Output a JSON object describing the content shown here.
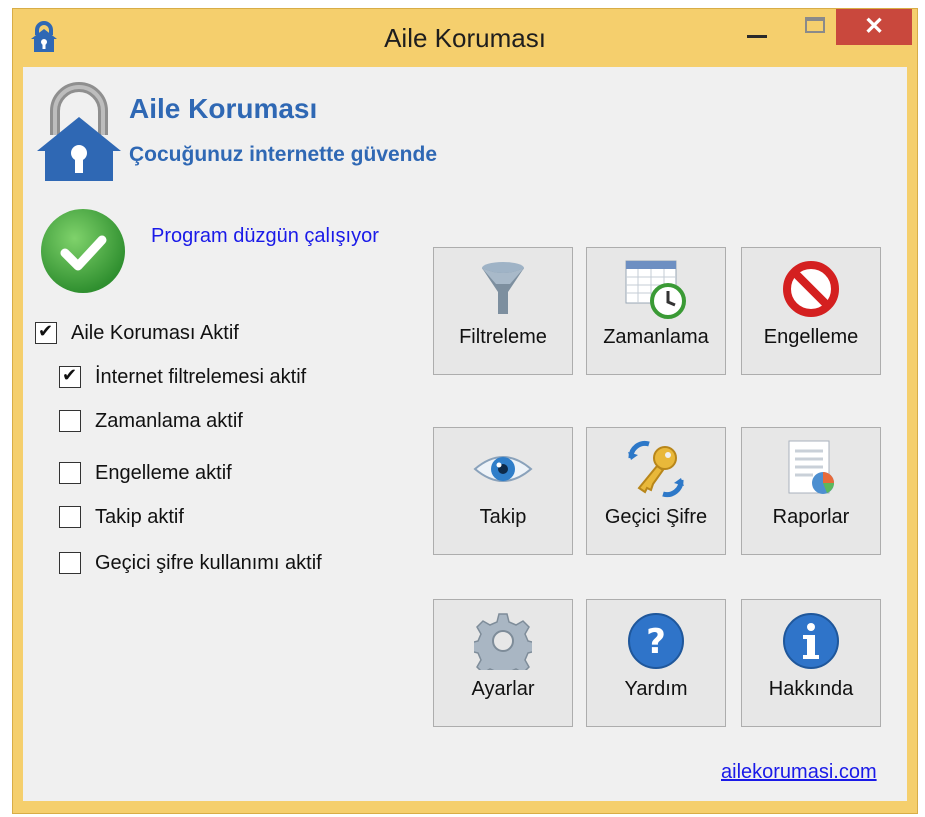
{
  "window": {
    "title": "Aile Koruması",
    "controls": {
      "minimize": "—",
      "maximize": "☐",
      "close": "✕"
    }
  },
  "brand": {
    "title": "Aile Koruması",
    "subtitle": "Çocuğunuz internette güvende"
  },
  "status": {
    "text": "Program düzgün çalışıyor",
    "icon": "check-circle-icon"
  },
  "settings": [
    {
      "label": "Aile Koruması Aktif",
      "checked": true
    },
    {
      "label": "İnternet filtrelemesi aktif",
      "checked": true
    },
    {
      "label": "Zamanlama aktif",
      "checked": false
    },
    {
      "label": "Engelleme aktif",
      "checked": false
    },
    {
      "label": "Takip aktif",
      "checked": false
    },
    {
      "label": "Geçici şifre kullanımı aktif",
      "checked": false
    }
  ],
  "tiles": [
    {
      "label": "Filtreleme",
      "icon": "funnel-icon"
    },
    {
      "label": "Zamanlama",
      "icon": "calendar-clock-icon"
    },
    {
      "label": "Engelleme",
      "icon": "prohibited-icon"
    },
    {
      "label": "Takip",
      "icon": "eye-icon"
    },
    {
      "label": "Geçici Şifre",
      "icon": "key-icon"
    },
    {
      "label": "Raporlar",
      "icon": "report-icon"
    },
    {
      "label": "Ayarlar",
      "icon": "gear-icon"
    },
    {
      "label": "Yardım",
      "icon": "help-icon"
    },
    {
      "label": "Hakkında",
      "icon": "info-icon"
    }
  ],
  "footer": {
    "link": "ailekorumasi.com"
  },
  "colors": {
    "frame": "#f5cf6d",
    "close": "#c9483d",
    "brand": "#2f68b4",
    "link": "#1a1ae8",
    "ok": "#3aa33a"
  }
}
